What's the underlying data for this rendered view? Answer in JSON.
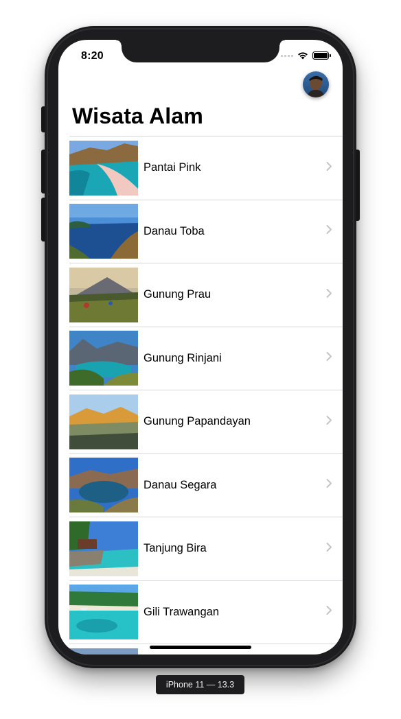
{
  "status_bar": {
    "time": "8:20"
  },
  "header": {
    "title": "Wisata Alam"
  },
  "list": {
    "items": [
      {
        "label": "Pantai Pink"
      },
      {
        "label": "Danau Toba"
      },
      {
        "label": "Gunung Prau"
      },
      {
        "label": "Gunung Rinjani"
      },
      {
        "label": "Gunung Papandayan"
      },
      {
        "label": "Danau Segara"
      },
      {
        "label": "Tanjung Bira"
      },
      {
        "label": "Gili Trawangan"
      }
    ]
  },
  "simulator": {
    "device_label": "iPhone 11 — 13.3"
  },
  "colors": {
    "frame": "#1d1d1f",
    "separator": "#d8d8dc",
    "chevron": "#c4c4c7"
  }
}
